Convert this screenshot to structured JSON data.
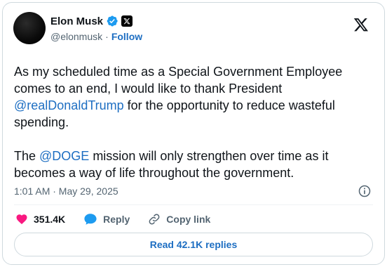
{
  "author": {
    "display_name": "Elon Musk",
    "handle": "@elonmusk",
    "separator": "·",
    "follow_label": "Follow"
  },
  "tweet": {
    "paragraph1_before": "As my scheduled time as a Special Government Employee comes to an end, I would like to thank President ",
    "paragraph1_mention": "@realDonaldTrump",
    "paragraph1_after": " for the opportunity to reduce wasteful spending.",
    "paragraph2_before": "The ",
    "paragraph2_mention": "@DOGE",
    "paragraph2_after": " mission will only strengthen over time as it becomes a way of life throughout the government.",
    "timestamp": "1:01 AM · May 29, 2025"
  },
  "actions": {
    "like_count": "351.4K",
    "reply_label": "Reply",
    "copy_link_label": "Copy link"
  },
  "read_replies_label": "Read 42.1K replies",
  "colors": {
    "link": "#1d6ec2",
    "verified": "#1d9bf0",
    "like": "#f91880",
    "muted": "#536471",
    "text": "#0f1419"
  }
}
